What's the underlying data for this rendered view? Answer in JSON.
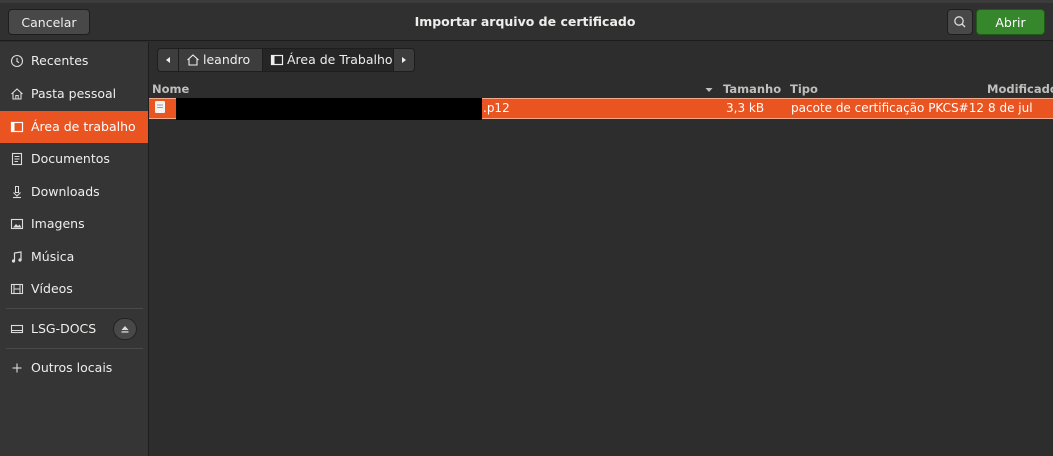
{
  "header": {
    "cancel_label": "Cancelar",
    "title": "Importar arquivo de certificado",
    "open_label": "Abrir"
  },
  "sidebar": {
    "items": [
      {
        "label": "Recentes",
        "icon": "clock-icon"
      },
      {
        "label": "Pasta pessoal",
        "icon": "home-icon"
      },
      {
        "label": "Área de trabalho",
        "icon": "desktop-icon",
        "active": true
      },
      {
        "label": "Documentos",
        "icon": "document-icon"
      },
      {
        "label": "Downloads",
        "icon": "download-icon"
      },
      {
        "label": "Imagens",
        "icon": "image-icon"
      },
      {
        "label": "Música",
        "icon": "music-icon"
      },
      {
        "label": "Vídeos",
        "icon": "film-icon"
      }
    ],
    "drive": {
      "label": "LSG-DOCS",
      "icon": "drive-icon"
    },
    "other": {
      "label": "Outros locais",
      "icon": "plus-icon"
    }
  },
  "pathbar": {
    "home": "leandro",
    "current": "Área de Trabalho"
  },
  "columns": {
    "name": "Nome",
    "size": "Tamanho",
    "type": "Tipo",
    "modified": "Modificado"
  },
  "files": [
    {
      "name": ".p12",
      "size": "3,3 kB",
      "type": "pacote de certificação PKCS#12",
      "modified": "8 de jul"
    }
  ],
  "colors": {
    "accent": "#e95420",
    "open_button": "#36862b",
    "background": "#2d2d2d",
    "sidebar": "#353535"
  }
}
